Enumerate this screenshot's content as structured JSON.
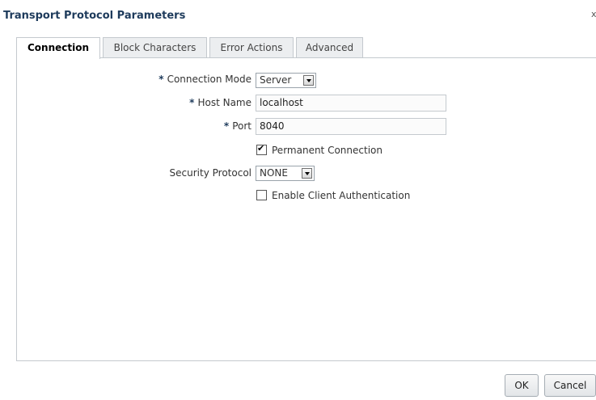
{
  "dialog": {
    "title": "Transport Protocol Parameters",
    "close_glyph": "x"
  },
  "tabs": [
    {
      "label": "Connection",
      "active": true
    },
    {
      "label": "Block Characters",
      "active": false
    },
    {
      "label": "Error Actions",
      "active": false
    },
    {
      "label": "Advanced",
      "active": false
    }
  ],
  "form": {
    "required_marker": "*",
    "connection_mode": {
      "label": "Connection Mode",
      "required": true,
      "value": "Server"
    },
    "host_name": {
      "label": "Host Name",
      "required": true,
      "value": "localhost"
    },
    "port": {
      "label": "Port",
      "required": true,
      "value": "8040"
    },
    "permanent_connection": {
      "label": "Permanent Connection",
      "checked": true
    },
    "security_protocol": {
      "label": "Security Protocol",
      "value": "NONE"
    },
    "enable_client_auth": {
      "label": "Enable Client Authentication",
      "checked": false
    }
  },
  "buttons": {
    "ok": "OK",
    "cancel": "Cancel"
  },
  "colors": {
    "title": "#1e3b5c",
    "tab_border": "#c4c9ce",
    "tab_inactive_bg": "#eceef0"
  },
  "icons": {
    "dropdown": "dropdown-arrow-icon",
    "checkbox": "checkmark-icon"
  }
}
